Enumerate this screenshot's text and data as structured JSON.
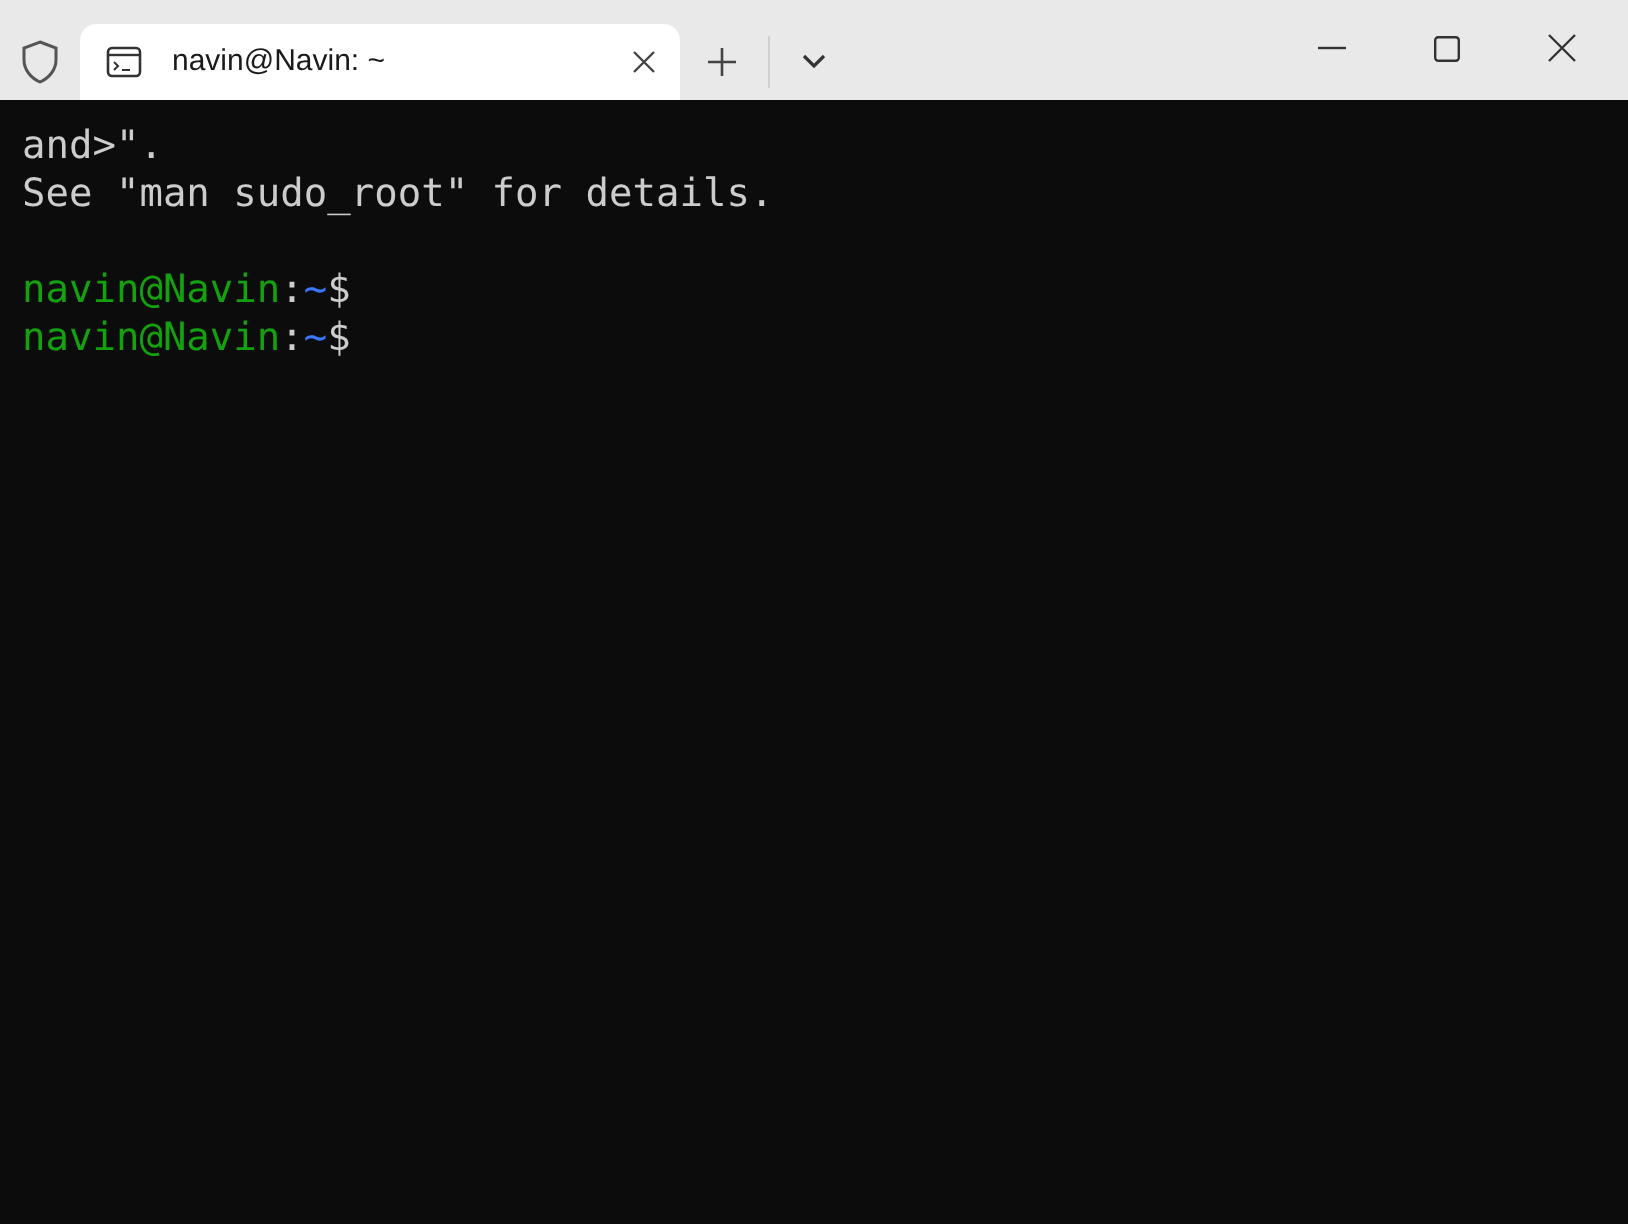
{
  "tabs": [
    {
      "title": "navin@Navin: ~",
      "selected": true
    }
  ],
  "terminal": {
    "lines": [
      {
        "kind": "output",
        "text": "and>\"."
      },
      {
        "kind": "output",
        "text": "See \"man sudo_root\" for details."
      },
      {
        "kind": "blank"
      },
      {
        "kind": "prompt",
        "user_host": "navin@Navin",
        "sep": ":",
        "path": "~",
        "symbol": "$"
      },
      {
        "kind": "prompt",
        "user_host": "navin@Navin",
        "sep": ":",
        "path": "~",
        "symbol": "$"
      }
    ]
  }
}
